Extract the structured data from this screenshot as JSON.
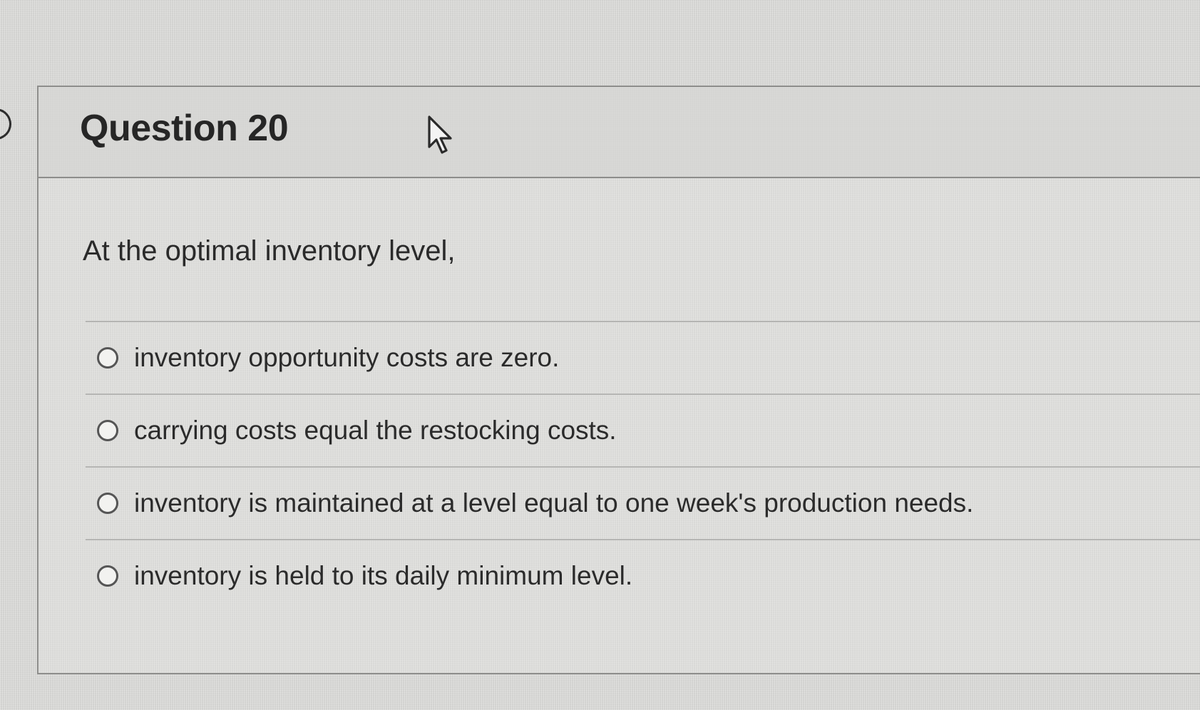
{
  "question": {
    "title": "Question 20",
    "text": "At the optimal inventory level,",
    "options": [
      {
        "label": "inventory opportunity costs are zero."
      },
      {
        "label": "carrying costs equal the restocking costs."
      },
      {
        "label": "inventory is maintained at a level equal to one week's production needs."
      },
      {
        "label": "inventory is held to its daily minimum level."
      }
    ]
  },
  "colors": {
    "background": "#dddddb",
    "border": "#8d8d8b",
    "text": "#2a2a2a"
  },
  "icons": {
    "cursor": "mouse-pointer-icon",
    "radio": "radio-unselected"
  }
}
